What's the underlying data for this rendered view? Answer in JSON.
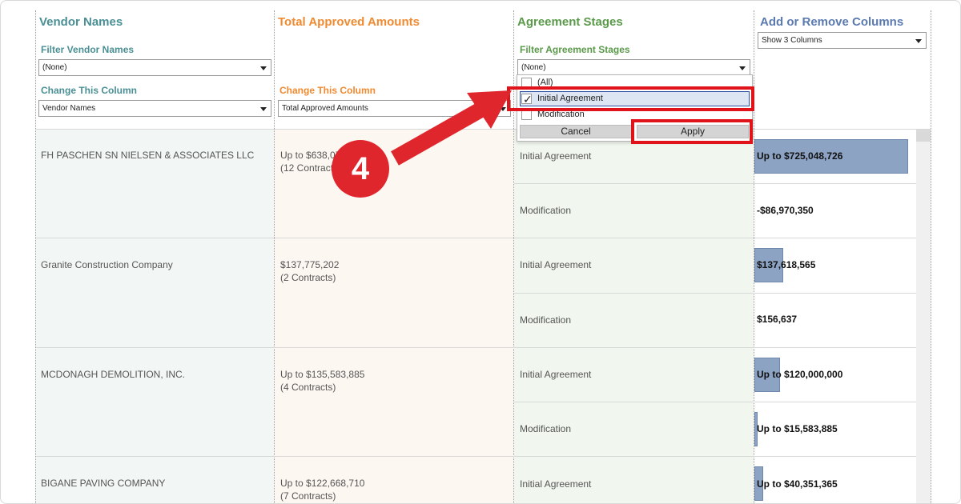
{
  "columns": {
    "vendor": {
      "title": "Vendor Names",
      "filter_label": "Filter Vendor Names",
      "filter_value": "(None)",
      "change_label": "Change This Column",
      "change_value": "Vendor Names"
    },
    "amount": {
      "title": "Total Approved Amounts",
      "change_label": "Change This Column",
      "change_value": "Total Approved Amounts"
    },
    "stage": {
      "title": "Agreement Stages",
      "filter_label": "Filter Agreement Stages",
      "filter_value": "(None)"
    },
    "addremove": {
      "title": "Add or Remove Columns",
      "select_value": "Show 3 Columns"
    }
  },
  "stage_dropdown": {
    "options": [
      {
        "label": "(All)",
        "checked": false
      },
      {
        "label": "Initial Agreement",
        "checked": true
      },
      {
        "label": "Modification",
        "checked": false
      }
    ],
    "cancel_label": "Cancel",
    "apply_label": "Apply"
  },
  "rows": [
    {
      "vendor": "FH PASCHEN SN NIELSEN & ASSOCIATES LLC",
      "amount_line1": "Up to $638,07",
      "amount_line2": "(12 Contracts)",
      "stages": [
        {
          "stage": "Initial Agreement",
          "value": "Up to $725,048,726",
          "bar_fraction": 1.0
        },
        {
          "stage": "Modification",
          "value": "-$86,970,350",
          "bar_fraction": 0
        }
      ]
    },
    {
      "vendor": "Granite Construction Company",
      "amount_line1": "$137,775,202",
      "amount_line2": "(2 Contracts)",
      "stages": [
        {
          "stage": "Initial Agreement",
          "value": "$137,618,565",
          "bar_fraction": 0.19
        },
        {
          "stage": "Modification",
          "value": "$156,637",
          "bar_fraction": 0
        }
      ]
    },
    {
      "vendor": "MCDONAGH DEMOLITION, INC.",
      "amount_line1": "Up to $135,583,885",
      "amount_line2": "(4 Contracts)",
      "stages": [
        {
          "stage": "Initial Agreement",
          "value": "Up to $120,000,000",
          "bar_fraction": 0.165
        },
        {
          "stage": "Modification",
          "value": "Up to $15,583,885",
          "bar_fraction": 0.02
        }
      ]
    },
    {
      "vendor": "BIGANE PAVING COMPANY",
      "amount_line1": "Up to $122,668,710",
      "amount_line2": "(7 Contracts)",
      "stages": [
        {
          "stage": "Initial Agreement",
          "value": "Up to $40,351,365",
          "bar_fraction": 0.056
        }
      ]
    }
  ],
  "annotation": {
    "step_number": "4"
  },
  "colors": {
    "highlight": "#e0131a",
    "bar": "#8ca3c4",
    "vendor_title": "#4a8f94",
    "amount_title": "#f08a30",
    "stage_title": "#5a9a4a",
    "addremove_title": "#5a7ab0"
  }
}
